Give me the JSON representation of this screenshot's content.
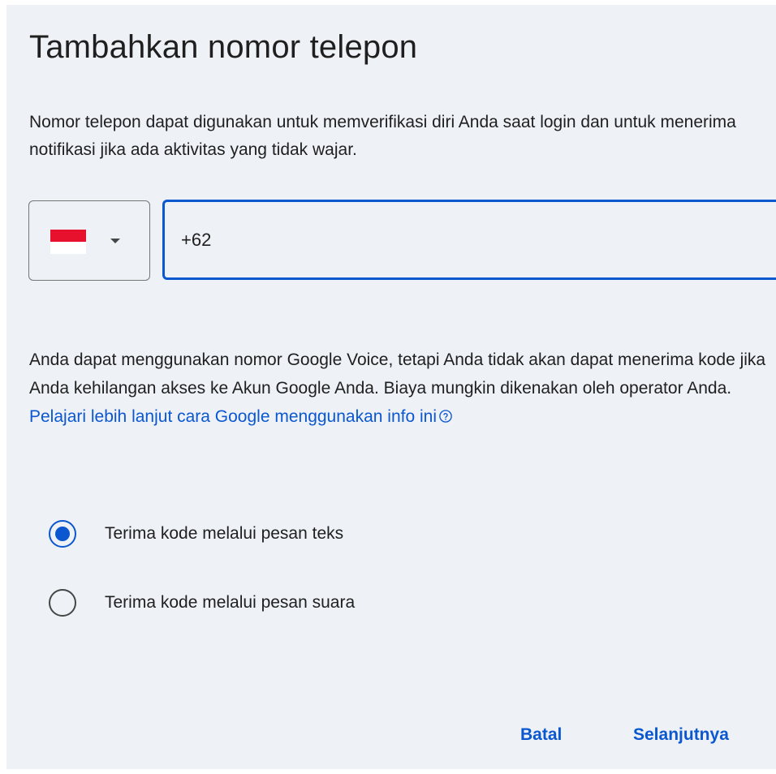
{
  "dialog": {
    "title": "Tambahkan nomor telepon",
    "description": "Nomor telepon dapat digunakan untuk memverifikasi diri Anda saat login dan untuk menerima notifikasi jika ada aktivitas yang tidak wajar.",
    "country_select": {
      "flag_icon": "indonesia-flag-icon",
      "caret_icon": "dropdown-caret-icon"
    },
    "phone_input": {
      "value": "+62"
    },
    "notice": {
      "text": "Anda dapat menggunakan nomor Google Voice, tetapi Anda tidak akan dapat menerima kode jika Anda kehilangan akses ke Akun Google Anda. Biaya mungkin dikenakan oleh operator Anda. ",
      "link": "Pelajari lebih lanjut cara Google menggunakan info ini",
      "help_icon": "help-circle-icon"
    },
    "options": [
      {
        "label": "Terima kode melalui pesan teks",
        "checked": true
      },
      {
        "label": "Terima kode melalui pesan suara",
        "checked": false
      }
    ],
    "actions": {
      "cancel": "Batal",
      "next": "Selanjutnya"
    }
  },
  "colors": {
    "background": "#eef1f6",
    "accent": "#0b57d0",
    "text": "#1f1f1f",
    "border": "#747775",
    "flag_red": "#e8112d",
    "flag_white": "#ffffff"
  }
}
